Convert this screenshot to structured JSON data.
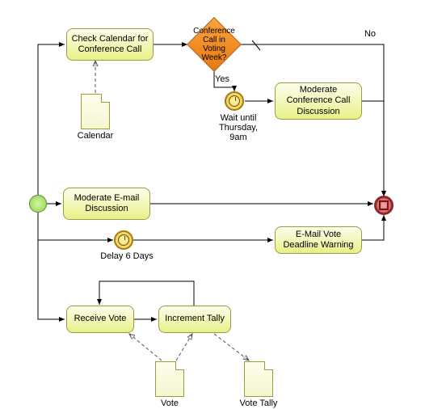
{
  "chart_data": {
    "type": "diagram",
    "notation": "BPMN",
    "start_event": {
      "id": "start"
    },
    "tasks": [
      {
        "id": "check-calendar",
        "label": "Check Calendar for Conference Call"
      },
      {
        "id": "moderate-call",
        "label": "Moderate Conference Call Discussion"
      },
      {
        "id": "moderate-email",
        "label": "Moderate E-mail Discussion"
      },
      {
        "id": "email-warning",
        "label": "E-Mail Vote Deadline Warning"
      },
      {
        "id": "receive-vote",
        "label": "Receive Vote"
      },
      {
        "id": "increment-tally",
        "label": "Increment Tally"
      }
    ],
    "gateways": [
      {
        "id": "voting-week-gw",
        "label": "Conference Call in Voting Week?",
        "outgoing": [
          "Yes",
          "No"
        ]
      }
    ],
    "intermediate_events": [
      {
        "id": "wait-thursday",
        "type": "timer",
        "label": "Wait until Thursday, 9am"
      },
      {
        "id": "delay-6-days",
        "type": "timer",
        "label": "Delay 6 Days"
      }
    ],
    "data_objects": [
      {
        "id": "calendar-doc",
        "label": "Calendar"
      },
      {
        "id": "vote-doc",
        "label": "Vote"
      },
      {
        "id": "vote-tally-doc",
        "label": "Vote Tally"
      }
    ],
    "end_event": {
      "id": "end",
      "type": "complex"
    },
    "flow_labels": {
      "yes": "Yes",
      "no": "No"
    }
  },
  "nodes": {
    "check_calendar": "Check Calendar for Conference Call",
    "gateway": "Conference Call in Voting Week?",
    "yes": "Yes",
    "no": "No",
    "wait_thursday": "Wait until Thursday, 9am",
    "moderate_call": "Moderate Conference Call Discussion",
    "calendar": "Calendar",
    "moderate_email": "Moderate E-mail Discussion",
    "delay6": "Delay 6 Days",
    "email_warning": "E-Mail Vote Deadline Warning",
    "receive_vote": "Receive Vote",
    "increment_tally": "Increment Tally",
    "vote": "Vote",
    "vote_tally": "Vote Tally"
  }
}
